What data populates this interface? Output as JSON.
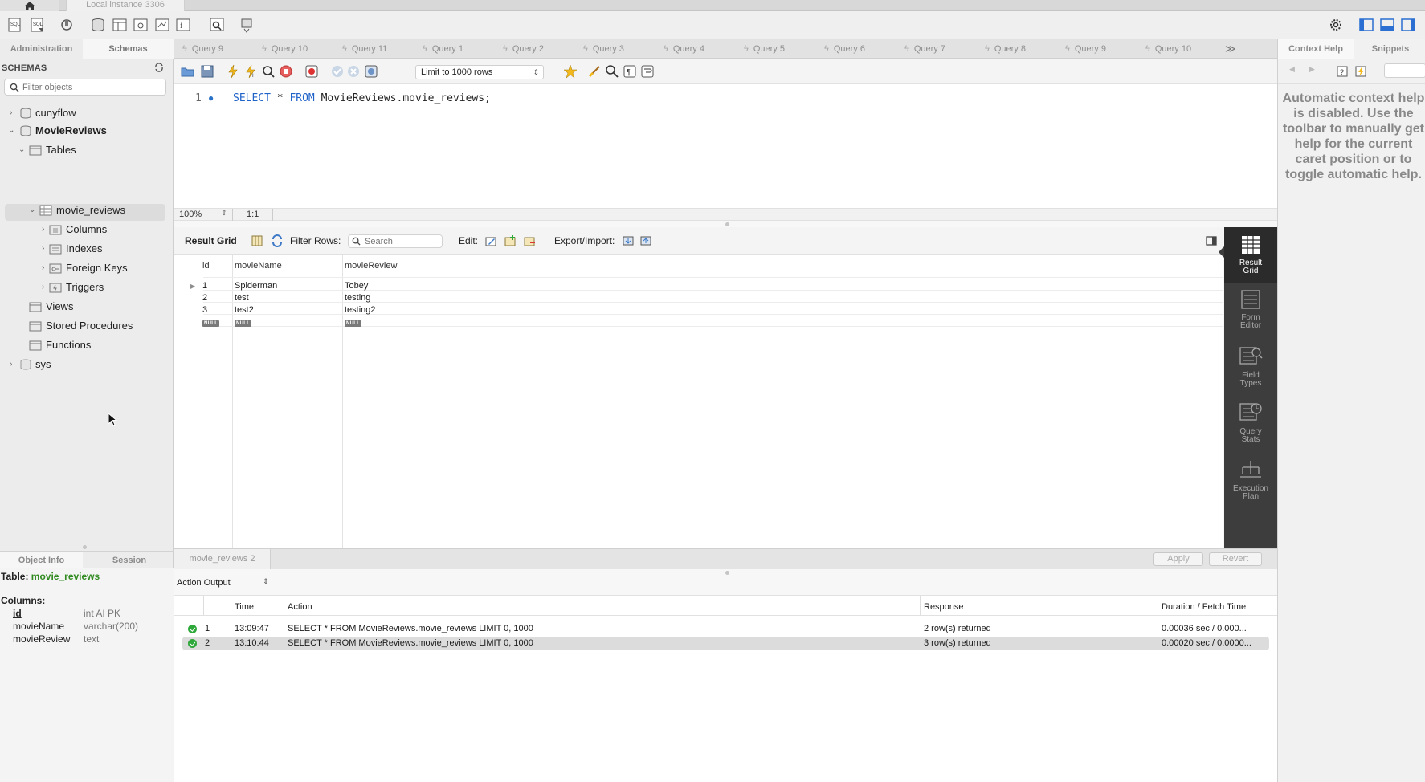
{
  "window": {
    "instance_tab": "Local instance 3306"
  },
  "sidebar": {
    "tabs": [
      "Administration",
      "Schemas"
    ],
    "schemas_heading": "SCHEMAS",
    "filter_placeholder": "Filter objects",
    "tree": {
      "cunyflow": "cunyflow",
      "moviereviews": "MovieReviews",
      "tables": "Tables",
      "movie_reviews": "movie_reviews",
      "columns": "Columns",
      "indexes": "Indexes",
      "foreign_keys": "Foreign Keys",
      "triggers": "Triggers",
      "views": "Views",
      "stored_procedures": "Stored Procedures",
      "functions": "Functions",
      "sys": "sys"
    },
    "info_tabs": [
      "Object Info",
      "Session"
    ],
    "object_info": {
      "table_label": "Table:",
      "table_name": "movie_reviews",
      "columns_label": "Columns:",
      "columns": [
        {
          "name": "id",
          "type": "int AI PK"
        },
        {
          "name": "movieName",
          "type": "varchar(200)"
        },
        {
          "name": "movieReview",
          "type": "text"
        }
      ]
    }
  },
  "query_tabs": [
    "Query 9",
    "Query 10",
    "Query 11",
    "Query 1",
    "Query 2",
    "Query 3",
    "Query 4",
    "Query 5",
    "Query 6",
    "Query 7",
    "Query 8",
    "Query 9",
    "Query 10"
  ],
  "query_tabs_more": "≫",
  "editor": {
    "limit": "Limit to 1000 rows",
    "line_number": "1",
    "sql_keyword_select": "SELECT",
    "sql_star": " * ",
    "sql_keyword_from": "FROM",
    "sql_rest": " MovieReviews.movie_reviews;",
    "zoom": "100%",
    "cursor_pos": "1:1"
  },
  "result_toolbar": {
    "result_grid": "Result Grid",
    "filter_rows": "Filter Rows:",
    "search_placeholder": "Search",
    "edit": "Edit:",
    "export_import": "Export/Import:"
  },
  "grid": {
    "columns": [
      "id",
      "movieName",
      "movieReview"
    ],
    "rows": [
      {
        "id": "1",
        "movieName": "Spiderman",
        "movieReview": "Tobey"
      },
      {
        "id": "2",
        "movieName": "test",
        "movieReview": "testing"
      },
      {
        "id": "3",
        "movieName": "test2",
        "movieReview": "testing2"
      }
    ],
    "null_label": "NULL"
  },
  "side_rail": [
    {
      "line1": "Result",
      "line2": "Grid"
    },
    {
      "line1": "Form",
      "line2": "Editor"
    },
    {
      "line1": "Field",
      "line2": "Types"
    },
    {
      "line1": "Query",
      "line2": "Stats"
    },
    {
      "line1": "Execution",
      "line2": "Plan"
    }
  ],
  "result_tab": "movie_reviews 2",
  "buttons": {
    "apply": "Apply",
    "revert": "Revert"
  },
  "output": {
    "selector": "Action Output",
    "headers": [
      "Time",
      "Action",
      "Response",
      "Duration / Fetch Time"
    ],
    "rows": [
      {
        "num": "1",
        "time": "13:09:47",
        "action": "SELECT * FROM MovieReviews.movie_reviews LIMIT 0, 1000",
        "response": "2 row(s) returned",
        "duration": "0.00036 sec / 0.000..."
      },
      {
        "num": "2",
        "time": "13:10:44",
        "action": "SELECT * FROM MovieReviews.movie_reviews LIMIT 0, 1000",
        "response": "3 row(s) returned",
        "duration": "0.00020 sec / 0.0000..."
      }
    ]
  },
  "right_panel": {
    "tabs": [
      "Context Help",
      "Snippets"
    ],
    "help_text": "Automatic context help is disabled. Use the toolbar to manually get help for the current caret position or to toggle automatic help."
  },
  "colors": {
    "accent_blue": "#1f63c9",
    "table_name_green": "#2f8a1f",
    "ok_green": "#2fa83b",
    "rail_dark": "#3d3d3d"
  }
}
